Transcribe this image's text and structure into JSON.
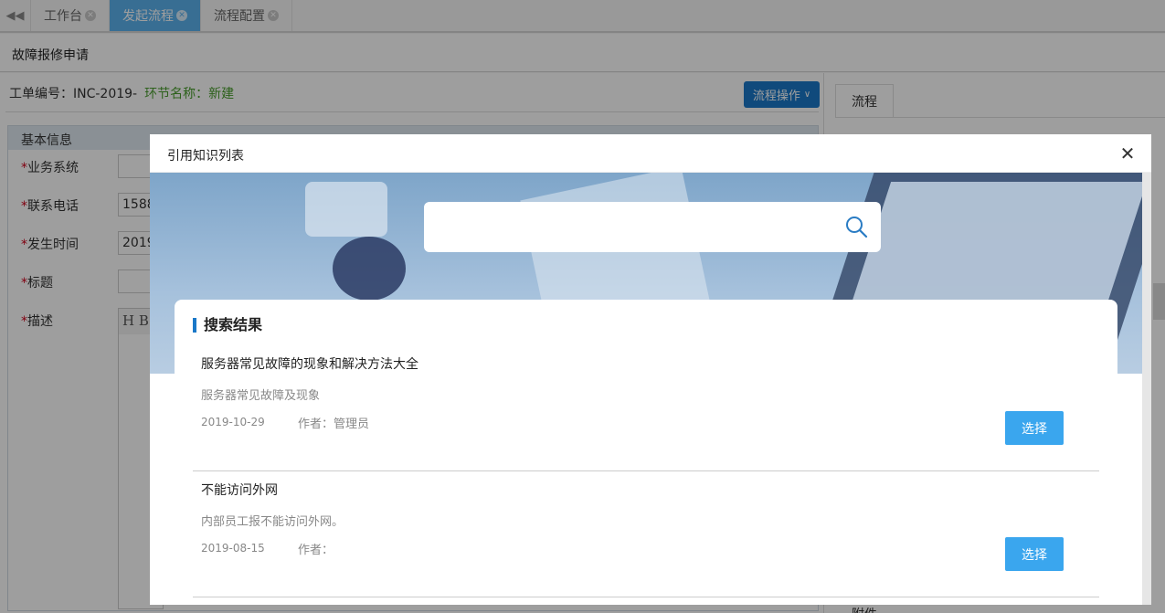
{
  "tabs": [
    {
      "label": "工作台",
      "active": false
    },
    {
      "label": "发起流程",
      "active": true
    },
    {
      "label": "流程配置",
      "active": false
    }
  ],
  "page": {
    "title": "故障报修申请"
  },
  "order": {
    "number_label": "工单编号：INC-2019-",
    "env_label": "环节名称：新建"
  },
  "flow_button": {
    "label": "流程操作"
  },
  "basic": {
    "title": "基本信息",
    "fields": [
      {
        "label": "业务系统",
        "value": ""
      },
      {
        "label": "联系电话",
        "value": "1588"
      },
      {
        "label": "发生时间",
        "value": "2019"
      },
      {
        "label": "标题",
        "value": ""
      },
      {
        "label": "描述",
        "value": ""
      }
    ],
    "required_mark": "*",
    "editor_toolbar": "H B"
  },
  "right_pane": {
    "tab": "流程",
    "attach_label": "附件"
  },
  "modal": {
    "title": "引用知识列表",
    "search": {
      "placeholder": "",
      "value": ""
    },
    "results_title": "搜索结果",
    "items": [
      {
        "title": "服务器常见故障的现象和解决方法大全",
        "summary": "服务器常见故障及现象",
        "date": "2019-10-29",
        "author": "作者：管理员",
        "button": "选择"
      },
      {
        "title": "不能访问外网",
        "summary": "内部员工报不能访问外网。",
        "date": "2019-08-15",
        "author": "作者：",
        "button": "选择"
      }
    ]
  },
  "colors": {
    "accent": "#1a78c8",
    "tab_active": "#5bb2ee",
    "select_button": "#3aa6ee",
    "env_text": "#4a9d2e"
  }
}
